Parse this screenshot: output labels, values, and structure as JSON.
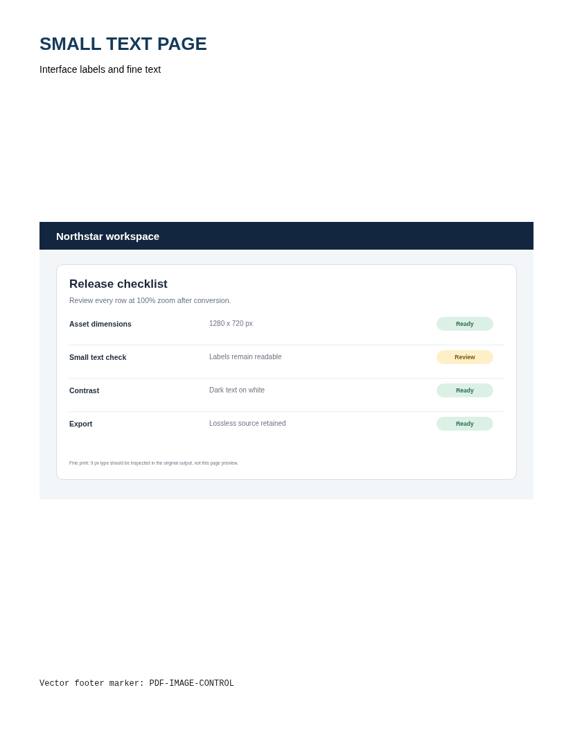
{
  "page": {
    "title": "SMALL TEXT PAGE",
    "subtitle": "Interface labels and fine text"
  },
  "app": {
    "header": {
      "title": "Northstar workspace"
    },
    "card": {
      "title": "Release checklist",
      "subtitle": "Review every row at 100% zoom after conversion.",
      "rows": [
        {
          "label": "Asset dimensions",
          "value": "1280 x 720 px",
          "status": {
            "kind": "ready",
            "text": "Ready"
          }
        },
        {
          "label": "Small text check",
          "value": "Labels remain readable",
          "status": {
            "kind": "review",
            "text": "Review"
          }
        },
        {
          "label": "Contrast",
          "value": "Dark text on white",
          "status": {
            "kind": "ready",
            "text": "Ready"
          }
        },
        {
          "label": "Export",
          "value": "Lossless source retained",
          "status": {
            "kind": "ready",
            "text": "Ready"
          }
        }
      ],
      "fine_print": "Fine print: 9 px type should be inspected in the original output, not this page preview."
    }
  },
  "footer": {
    "text": "Vector footer marker: PDF-IMAGE-CONTROL"
  }
}
